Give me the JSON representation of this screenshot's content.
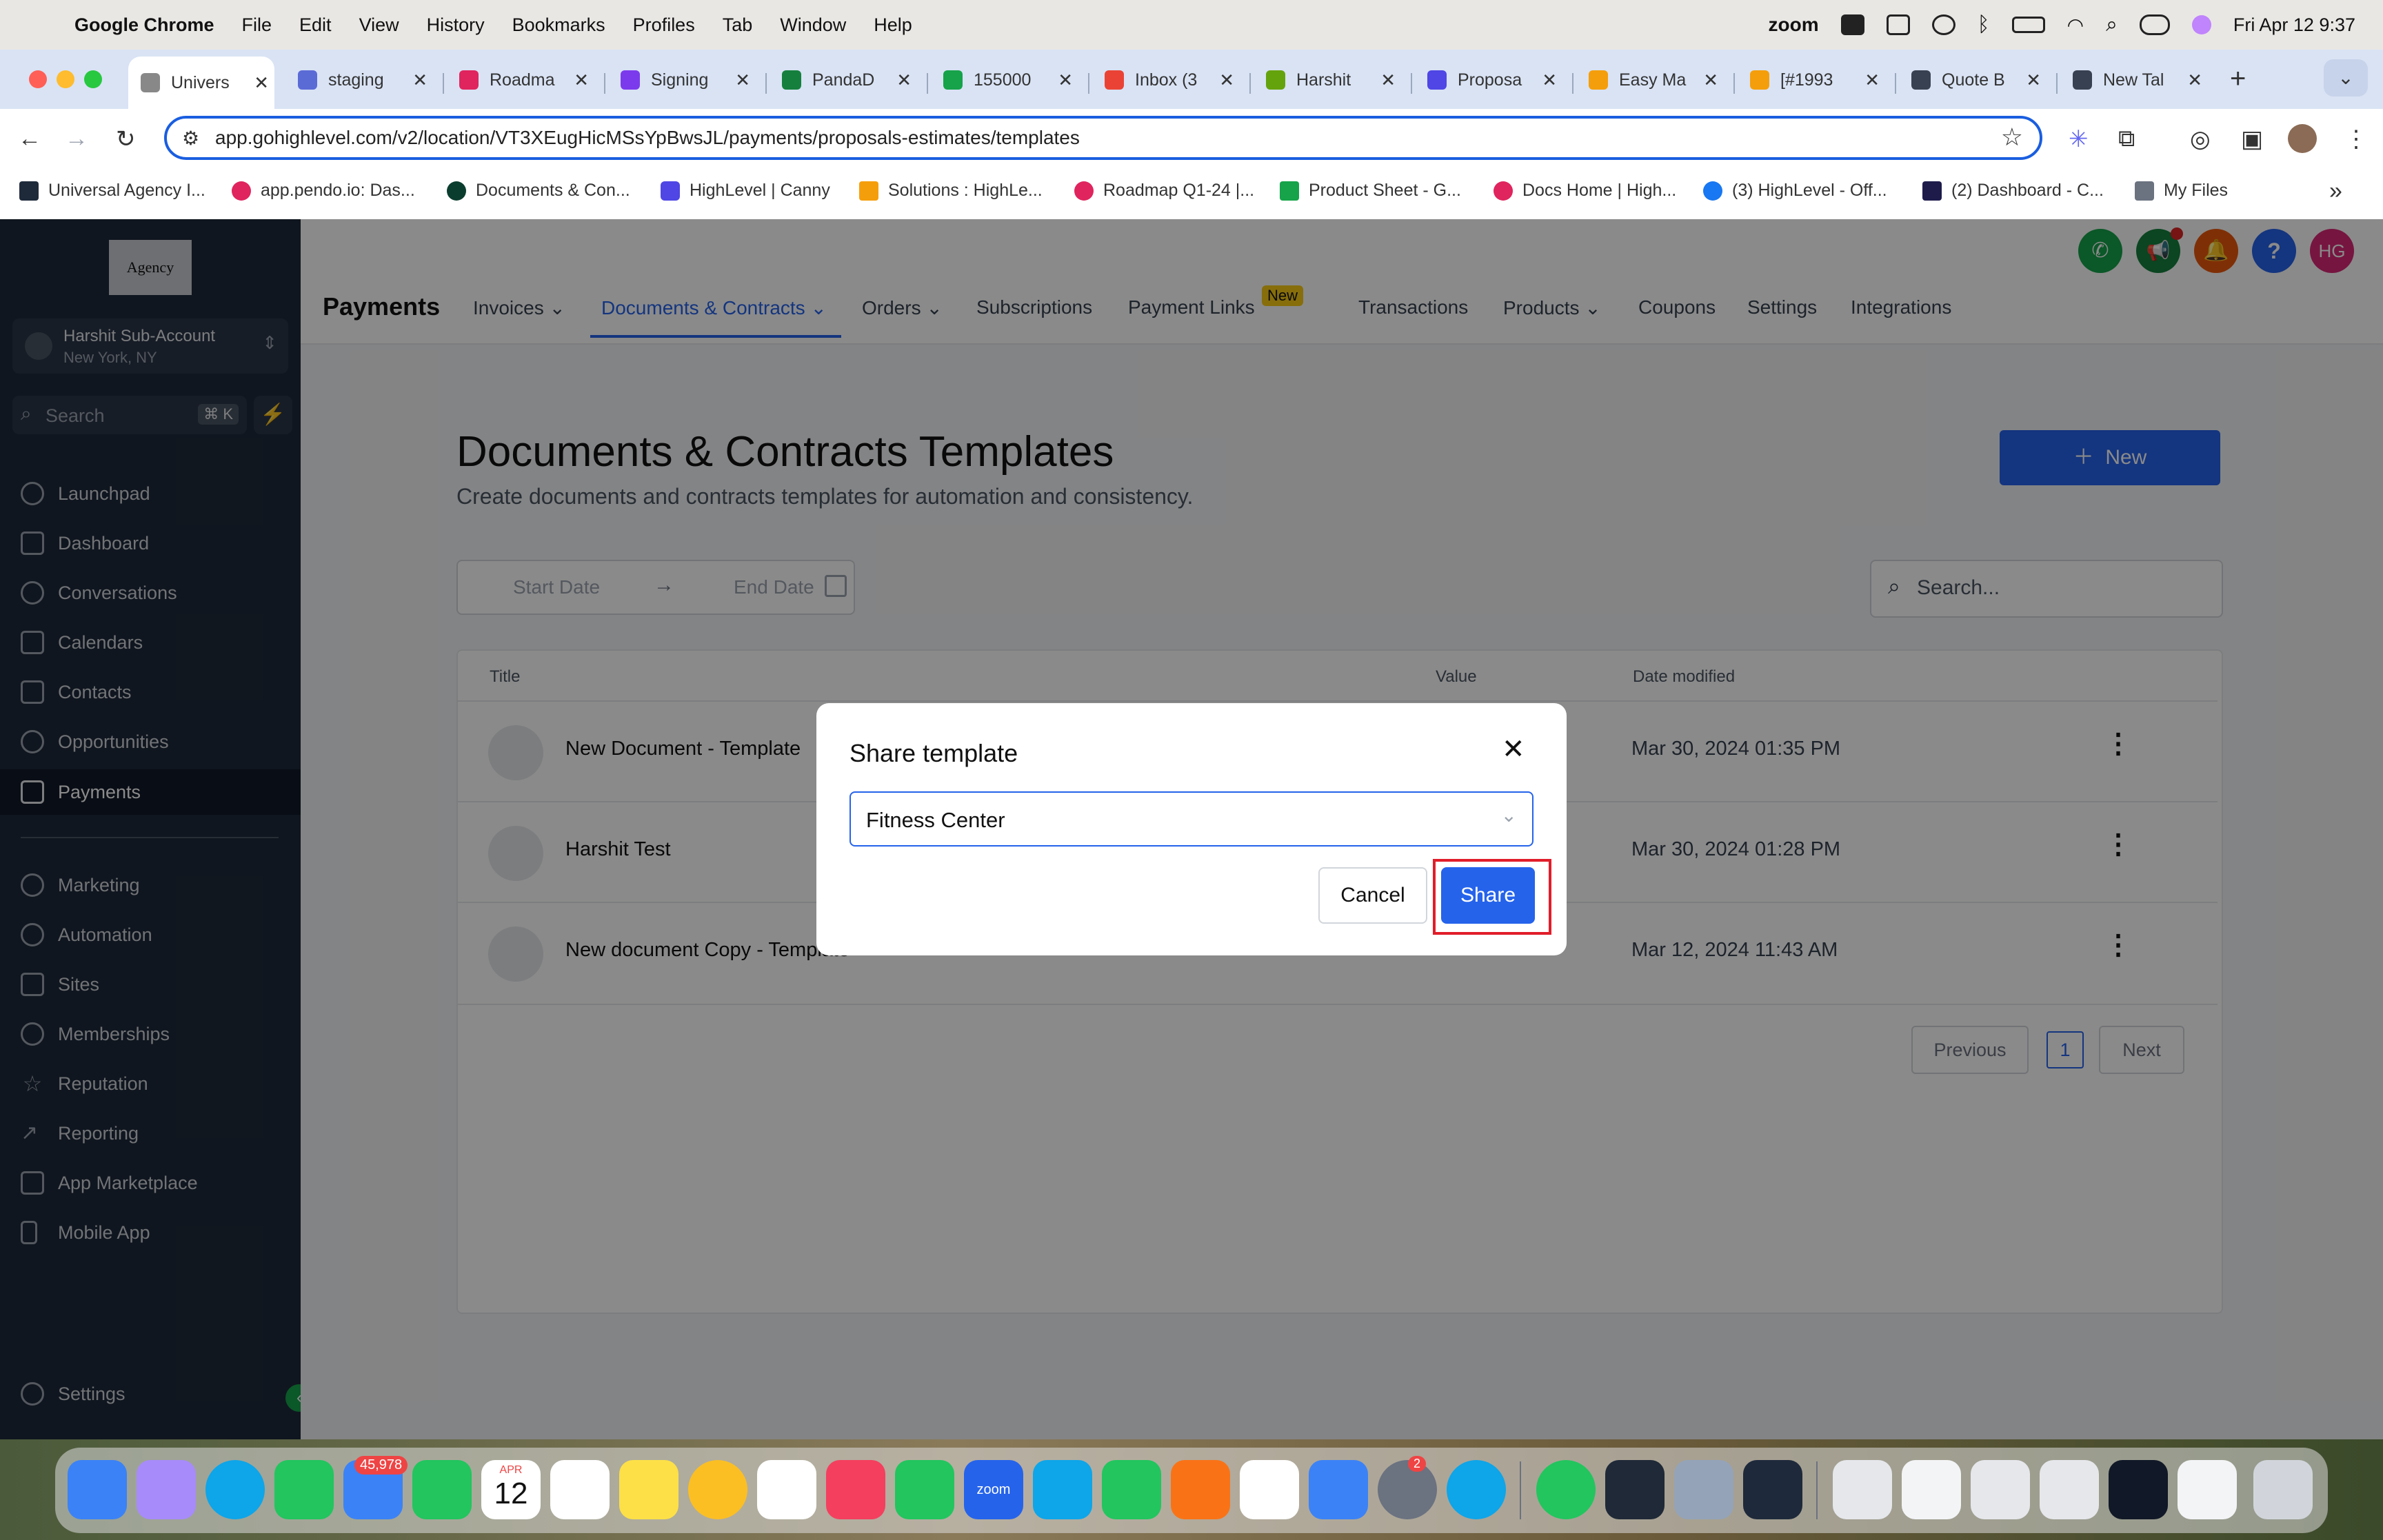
{
  "menubar": {
    "app_name": "Google Chrome",
    "items": [
      "File",
      "Edit",
      "View",
      "History",
      "Bookmarks",
      "Profiles",
      "Tab",
      "Window",
      "Help"
    ],
    "zoom_label": "zoom",
    "datetime": "Fri Apr 12  9:37"
  },
  "tabs": [
    {
      "label": "Univers",
      "icon_color": "#1e2a3a"
    },
    {
      "label": "staging",
      "icon_color": "#5b6bd6"
    },
    {
      "label": "Roadma",
      "icon_color": "#e0245e"
    },
    {
      "label": "Signing",
      "icon_color": "#7c3aed"
    },
    {
      "label": "PandaD",
      "icon_color": "#15803d"
    },
    {
      "label": "155000",
      "icon_color": "#16a34a"
    },
    {
      "label": "Inbox (3",
      "icon_color": "#ea4335"
    },
    {
      "label": "Harshit",
      "icon_color": "#65a30d"
    },
    {
      "label": "Proposa",
      "icon_color": "#4f46e5"
    },
    {
      "label": "Easy Ma",
      "icon_color": "#f59e0b"
    },
    {
      "label": "[#1993",
      "icon_color": "#f59e0b"
    },
    {
      "label": "Quote B",
      "icon_color": "#374151"
    },
    {
      "label": "New Tal",
      "icon_color": "#374151"
    }
  ],
  "address_bar": {
    "url": "app.gohighlevel.com/v2/location/VT3XEugHicMSsYpBwsJL/payments/proposals-estimates/templates"
  },
  "bookmarks": [
    "Universal Agency I...",
    "app.pendo.io: Das...",
    "Documents & Con...",
    "HighLevel | Canny",
    "Solutions : HighLe...",
    "Roadmap Q1-24 |...",
    "Product Sheet - G...",
    "Docs Home | High...",
    "(3) HighLevel - Off...",
    "(2) Dashboard - C...",
    "My Files"
  ],
  "sidebar": {
    "logo_text": "Agency",
    "account_name": "Harshit Sub-Account",
    "account_location": "New York, NY",
    "search_placeholder": "Search",
    "search_shortcut": "⌘ K",
    "items": [
      "Launchpad",
      "Dashboard",
      "Conversations",
      "Calendars",
      "Contacts",
      "Opportunities",
      "Payments"
    ],
    "items2": [
      "Marketing",
      "Automation",
      "Sites",
      "Memberships",
      "Reputation",
      "Reporting",
      "App Marketplace",
      "Mobile App"
    ],
    "settings_label": "Settings"
  },
  "header": {
    "title": "Payments",
    "nav": [
      "Invoices",
      "Documents & Contracts",
      "Orders",
      "Subscriptions",
      "Payment Links",
      "Transactions",
      "Products",
      "Coupons",
      "Settings",
      "Integrations"
    ],
    "new_badge": "New",
    "avatar_initials": "HG"
  },
  "main": {
    "title": "Documents & Contracts Templates",
    "subtitle": "Create documents and contracts templates for automation and consistency.",
    "new_button": "New",
    "start_date_placeholder": "Start Date",
    "end_date_placeholder": "End Date",
    "search_placeholder": "Search...",
    "columns": [
      "Title",
      "Value",
      "Date modified"
    ],
    "rows": [
      {
        "title": "New Document - Template",
        "value": "",
        "date": "Mar 30, 2024 01:35 PM"
      },
      {
        "title": "Harshit Test",
        "value": "",
        "date": "Mar 30, 2024 01:28 PM"
      },
      {
        "title": "New document Copy - Template",
        "value": "-",
        "date": "Mar 12, 2024 11:43 AM"
      }
    ],
    "pagination": {
      "previous": "Previous",
      "current": "1",
      "next": "Next"
    }
  },
  "modal": {
    "title": "Share template",
    "selected_option": "Fitness Center",
    "cancel_label": "Cancel",
    "share_label": "Share"
  },
  "dock": {
    "mail_badge": "45,978",
    "calendar_month": "APR",
    "calendar_day": "12",
    "settings_badge": "2",
    "zoom_label": "zoom"
  }
}
